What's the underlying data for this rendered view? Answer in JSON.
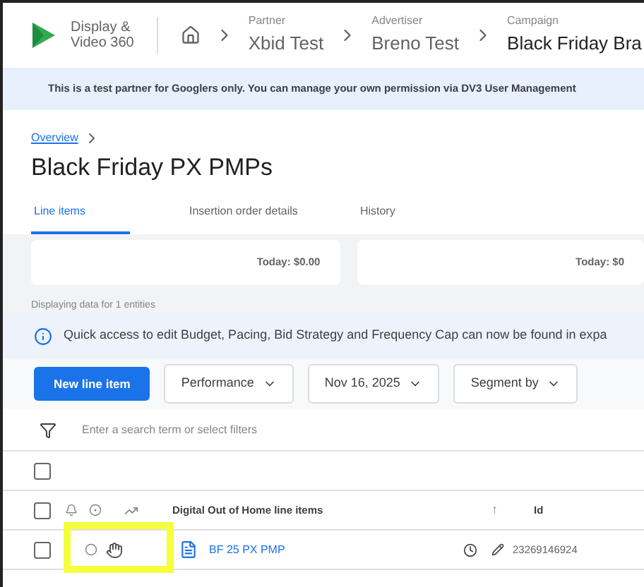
{
  "header": {
    "product": [
      "Display &",
      "Video 360"
    ],
    "breadcrumbs": [
      {
        "label": "Partner",
        "value": "Xbid Test"
      },
      {
        "label": "Advertiser",
        "value": "Breno Test"
      },
      {
        "label": "Campaign",
        "value": "Black Friday Bra"
      }
    ]
  },
  "notice": "This is a test partner for Googlers only. You can manage your own permission via DV3 User Management",
  "overview_link": "Overview",
  "page_title": "Black Friday PX PMPs",
  "tabs": [
    {
      "label": "Line items",
      "selected": true
    },
    {
      "label": "Insertion order details",
      "selected": false
    },
    {
      "label": "History",
      "selected": false
    }
  ],
  "cards": [
    {
      "text": "Today: $0.00"
    },
    {
      "text": "Today: $0"
    }
  ],
  "entities_note": "Displaying data for 1 entities",
  "info_banner": "Quick access to edit Budget, Pacing, Bid Strategy and Frequency Cap can now be found in expa",
  "toolbar": {
    "primary": "New line item",
    "dropdowns": [
      "Performance",
      "Nov 16, 2025",
      "Segment by"
    ]
  },
  "filter": {
    "placeholder": "Enter a search term or select filters"
  },
  "table": {
    "select_all_checked": false,
    "group_checked": false,
    "group_title": "Digital Out of Home line items",
    "sort_arrow": "↑",
    "id_header": "Id",
    "rows": [
      {
        "checked": false,
        "name": "BF 25 PX PMP",
        "id": "23269146924",
        "highlighted": true
      }
    ]
  }
}
